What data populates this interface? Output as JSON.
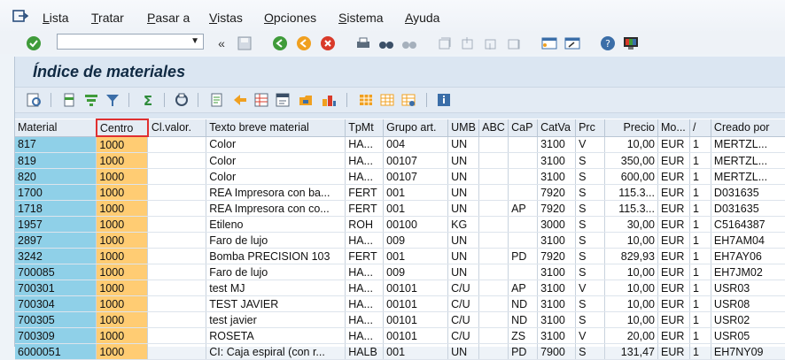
{
  "menubar": {
    "icon": "menu-exit-icon",
    "items": [
      "Lista",
      "Tratar",
      "Pasar a",
      "Vistas",
      "Opciones",
      "Sistema",
      "Ayuda"
    ],
    "accel": [
      "L",
      "T",
      "P",
      "V",
      "O",
      "S",
      "A"
    ]
  },
  "toolbar": {
    "command_field_value": "",
    "icons": [
      "enter-check-icon",
      "command-dropdown-icon",
      "collapse-icon",
      "save-icon",
      "back-icon",
      "exit-icon",
      "cancel-icon",
      "print-icon",
      "find-icon",
      "find-next-icon",
      "first-page-icon",
      "previous-page-icon",
      "next-page-icon",
      "last-page-icon",
      "create-session-icon",
      "shortcut-icon",
      "help-icon",
      "customize-layout-icon"
    ]
  },
  "page": {
    "title": "Índice de materiales"
  },
  "alv_toolbar": {
    "icons": [
      "details-icon",
      "sort-ascending-icon",
      "sort-descending-icon",
      "filter-icon",
      "total-icon",
      "subtotal-icon",
      "print-preview-icon",
      "export-icon",
      "spreadsheet-icon",
      "word-processing-icon",
      "local-file-icon",
      "mail-icon",
      "abc-analysis-icon",
      "choose-layout-icon",
      "change-layout-icon",
      "save-layout-icon",
      "info-icon"
    ]
  },
  "table": {
    "columns": [
      "Material",
      "Centro",
      "Cl.valor.",
      "Texto breve material",
      "TpMt",
      "Grupo art.",
      "UMB",
      "ABC",
      "CaP",
      "CatVa",
      "Prc",
      "Precio",
      "Mo...",
      "/",
      "Creado por"
    ],
    "rows": [
      [
        "817",
        "1000",
        "",
        "Color",
        "HA...",
        "004",
        "UN",
        "",
        "",
        "3100",
        "V",
        "10,00",
        "EUR",
        "1",
        "MERTZL..."
      ],
      [
        "819",
        "1000",
        "",
        "Color",
        "HA...",
        "00107",
        "UN",
        "",
        "",
        "3100",
        "S",
        "350,00",
        "EUR",
        "1",
        "MERTZL..."
      ],
      [
        "820",
        "1000",
        "",
        "Color",
        "HA...",
        "00107",
        "UN",
        "",
        "",
        "3100",
        "S",
        "600,00",
        "EUR",
        "1",
        "MERTZL..."
      ],
      [
        "1700",
        "1000",
        "",
        "REA Impresora con ba...",
        "FERT",
        "001",
        "UN",
        "",
        "",
        "7920",
        "S",
        "115.3...",
        "EUR",
        "1",
        "D031635"
      ],
      [
        "1718",
        "1000",
        "",
        "REA Impresora con co...",
        "FERT",
        "001",
        "UN",
        "",
        "AP",
        "7920",
        "S",
        "115.3...",
        "EUR",
        "1",
        "D031635"
      ],
      [
        "1957",
        "1000",
        "",
        "Etileno",
        "ROH",
        "00100",
        "KG",
        "",
        "",
        "3000",
        "S",
        "30,00",
        "EUR",
        "1",
        "C5164387"
      ],
      [
        "2897",
        "1000",
        "",
        "Faro de lujo",
        "HA...",
        "009",
        "UN",
        "",
        "",
        "3100",
        "S",
        "10,00",
        "EUR",
        "1",
        "EH7AM04"
      ],
      [
        "3242",
        "1000",
        "",
        "Bomba PRECISION 103",
        "FERT",
        "001",
        "UN",
        "",
        "PD",
        "7920",
        "S",
        "829,93",
        "EUR",
        "1",
        "EH7AY06"
      ],
      [
        "700085",
        "1000",
        "",
        "Faro de lujo",
        "HA...",
        "009",
        "UN",
        "",
        "",
        "3100",
        "S",
        "10,00",
        "EUR",
        "1",
        "EH7JM02"
      ],
      [
        "700301",
        "1000",
        "",
        "test MJ",
        "HA...",
        "00101",
        "C/U",
        "",
        "AP",
        "3100",
        "V",
        "10,00",
        "EUR",
        "1",
        "USR03"
      ],
      [
        "700304",
        "1000",
        "",
        "TEST JAVIER",
        "HA...",
        "00101",
        "C/U",
        "",
        "ND",
        "3100",
        "S",
        "10,00",
        "EUR",
        "1",
        "USR08"
      ],
      [
        "700305",
        "1000",
        "",
        "test javier",
        "HA...",
        "00101",
        "C/U",
        "",
        "ND",
        "3100",
        "S",
        "10,00",
        "EUR",
        "1",
        "USR02"
      ],
      [
        "700309",
        "1000",
        "",
        "ROSETA",
        "HA...",
        "00101",
        "C/U",
        "",
        "ZS",
        "3100",
        "V",
        "20,00",
        "EUR",
        "1",
        "USR05"
      ],
      [
        "6000051",
        "1000",
        "",
        "CI: Caja espiral (con r...",
        "HALB",
        "001",
        "UN",
        "",
        "PD",
        "7900",
        "S",
        "131,47",
        "EUR",
        "1",
        "EH7NY09"
      ]
    ]
  },
  "colors": {
    "key_column": "#8fd0e8",
    "plant_column": "#ffcc73",
    "selected_header_border": "#e03030"
  }
}
